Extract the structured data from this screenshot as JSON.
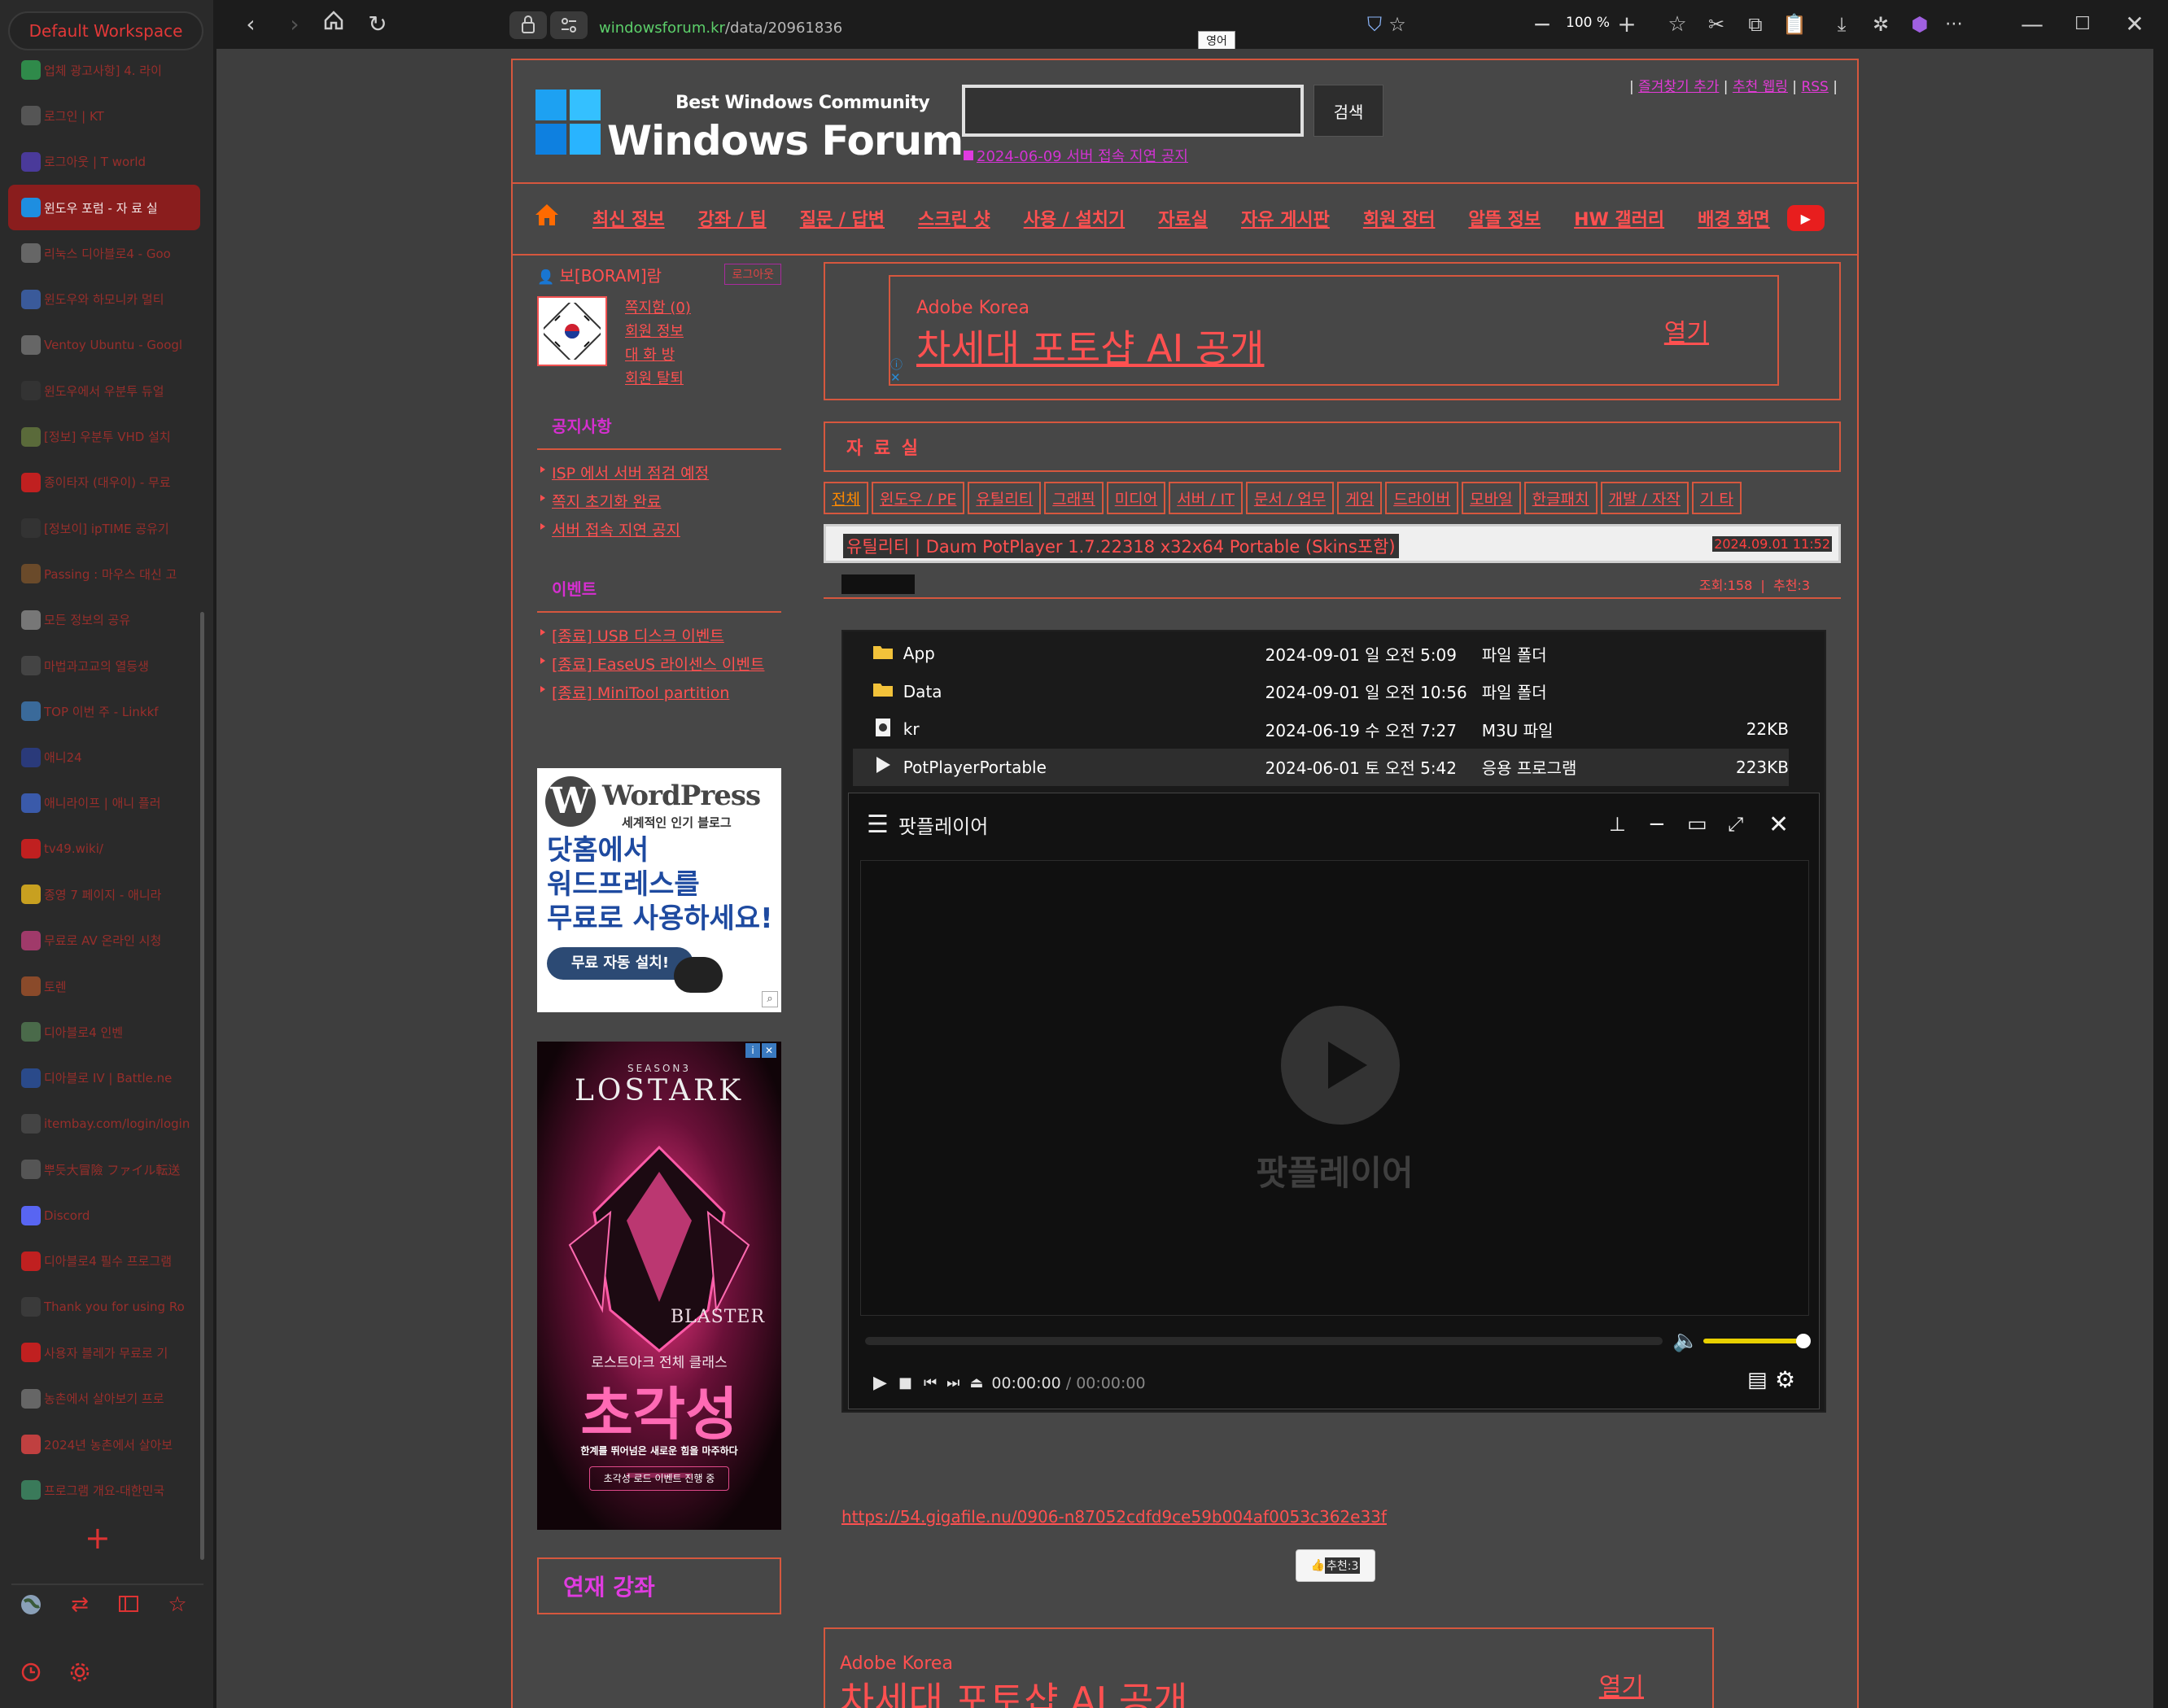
{
  "sidebar": {
    "workspace": "Default Workspace",
    "tabs": [
      {
        "label": "업체 광고사항] 4. 라이",
        "color": "#2f8a4a"
      },
      {
        "label": "로그인 | KT",
        "color": "#555"
      },
      {
        "label": "로그아웃 | T world",
        "color": "#4a3a9a"
      },
      {
        "label": "윈도우 포럼 - 자 료 실",
        "color": "#1e8ee0",
        "active": true
      },
      {
        "label": "리눅스 디아블로4 - Goo",
        "color": "#666"
      },
      {
        "label": "윈도우와 하모니카 멀티",
        "color": "#3a5a9a"
      },
      {
        "label": "Ventoy Ubuntu - Googl",
        "color": "#666"
      },
      {
        "label": "윈도우에서 우분투 듀얼",
        "color": "#333"
      },
      {
        "label": "[정보] 우분투 VHD 설치",
        "color": "#5a6a3a"
      },
      {
        "label": "종이타자 (대우이) - 무료",
        "color": "#c02020"
      },
      {
        "label": "[정보이] ipTIME 공유기",
        "color": "#333"
      },
      {
        "label": "Passing : 마우스 대신 고",
        "color": "#6a4a2a"
      },
      {
        "label": "모든 정보의 공유",
        "color": "#777"
      },
      {
        "label": "마법과고교의 열등생",
        "color": "#444"
      },
      {
        "label": "TOP 이번 주 - Linkkf",
        "color": "#3a6a9a"
      },
      {
        "label": "애니24",
        "color": "#2a3a7a"
      },
      {
        "label": "애니라이프 | 애니 플러",
        "color": "#3a5aaa"
      },
      {
        "label": "tv49.wiki/",
        "color": "#c02020"
      },
      {
        "label": "종영 7 페이지 - 애니라",
        "color": "#c8a020"
      },
      {
        "label": "무료로 AV 온라인 시청",
        "color": "#a03a6a"
      },
      {
        "label": "토렌",
        "color": "#8a4a2a"
      },
      {
        "label": "디아블로4 인벤",
        "color": "#4a6a4a"
      },
      {
        "label": "디아블로 IV | Battle.ne",
        "color": "#2a4a8a"
      },
      {
        "label": "itembay.com/login/login",
        "color": "#444"
      },
      {
        "label": "뿌듯大冒險 ファイル転送",
        "color": "#555"
      },
      {
        "label": "Discord",
        "color": "#5865f2"
      },
      {
        "label": "디아블로4 필수 프로그램",
        "color": "#c02020"
      },
      {
        "label": "Thank you for using Ro",
        "color": "#3a3a3a"
      },
      {
        "label": "사용자 블레가 무료로 기",
        "color": "#c02020"
      },
      {
        "label": "농촌에서 살아보기 프로",
        "color": "#666"
      },
      {
        "label": "2024년 농촌에서 살아보",
        "color": "#c04040"
      },
      {
        "label": "프로그램 개요-대한민국",
        "color": "#3a7a5a"
      }
    ]
  },
  "toolbar": {
    "url_host": "windowsforum.kr",
    "url_path": "/data/20961836",
    "lang_tooltip": "영어",
    "zoom": "100 %"
  },
  "site": {
    "logo_small": "Best Windows Community",
    "logo_big": "Windows Forum",
    "search_button": "검색",
    "search_value": "",
    "top_notice": "2024-06-09  서버 접속 지연 공지",
    "top_links": [
      "즐겨찾기 추가",
      "추천 웹링",
      "RSS"
    ],
    "nav": [
      "최신 정보",
      "강좌 / 팁",
      "질문 / 답변",
      "스크린 샷",
      "사용 / 설치기",
      "자료실",
      "자유 게시판",
      "회원 장터",
      "알뜰 정보",
      "HW 갤러리",
      "배경 화면"
    ]
  },
  "user": {
    "name": "보[BORAM]람",
    "logout": "로그아웃",
    "links": [
      "쪽지함 (0)",
      "회원 정보",
      "대 화 방",
      "회원 탈퇴"
    ]
  },
  "notices": {
    "title": "공지사항",
    "items": [
      "ISP 에서 서버 점검 예정",
      "쪽지 초기화 완료",
      "서버 접속 지연 공지"
    ]
  },
  "events": {
    "title": "이벤트",
    "items": [
      "[종료] USB 디스크 이벤트",
      "[종료] EaseUS 라이센스 이벤트",
      "[종료] MiniTool partition"
    ]
  },
  "wp_ad": {
    "brand": "WordPress",
    "tag": "세계적인 인기 블로그",
    "l1": "닷홈에서",
    "l2": "워드프레스를",
    "l3": "무료로 사용하세요!",
    "btn": "무료 자동 설치!"
  },
  "lostark_ad": {
    "season": "SEASON3",
    "title": "LOSTARK",
    "blaster": "BLASTER",
    "sub": "로스트아크 전체 클래스",
    "big": "초각성",
    "desc": "한계를 뛰어넘은 새로운 힘을 마주하다",
    "badge": "초각성 로드 이벤트 진행 중"
  },
  "serial_label": "연재 강좌",
  "ad": {
    "brand": "Adobe Korea",
    "headline": "차세대 포토샵 AI 공개",
    "open": "열기"
  },
  "board": {
    "title": "자 료 실",
    "categories": [
      "전체",
      "윈도우 / PE",
      "유틸리티",
      "그래픽",
      "미디어",
      "서버 / IT",
      "문서 / 업무",
      "게임",
      "드라이버",
      "모바일",
      "한글패치",
      "개발 / 자작",
      "기 타"
    ],
    "post_title": "유틸리티  |  Daum PotPlayer 1.7.22318 x32x64 Portable (Skins포함)",
    "post_date": "2024.09.01 11:52",
    "views": "조회:158",
    "recommend": "추천:3"
  },
  "explorer": {
    "rows": [
      {
        "icon": "folder-icon",
        "name": "App",
        "date": "2024-09-01 일 오전 5:09",
        "type": "파일 폴더",
        "size": ""
      },
      {
        "icon": "folder-icon",
        "name": "Data",
        "date": "2024-09-01 일 오전 10:56",
        "type": "파일 폴더",
        "size": ""
      },
      {
        "icon": "file-icon",
        "name": "kr",
        "date": "2024-06-19 수 오전 7:27",
        "type": "M3U 파일",
        "size": "22KB"
      },
      {
        "icon": "play-app-icon",
        "name": "PotPlayerPortable",
        "date": "2024-06-01 토 오전 5:42",
        "type": "응용 프로그램",
        "size": "223KB"
      }
    ]
  },
  "potplayer": {
    "title": "팟플레이어",
    "center_label": "팟플레이어",
    "time_current": "00:00:00",
    "time_total": "00:00:00",
    "volume_level": 1.0
  },
  "download_link": "https://54.gigafile.nu/0906-n87052cdfd9ce59b004af0053c362e33f",
  "recommend_button": "추천:3"
}
